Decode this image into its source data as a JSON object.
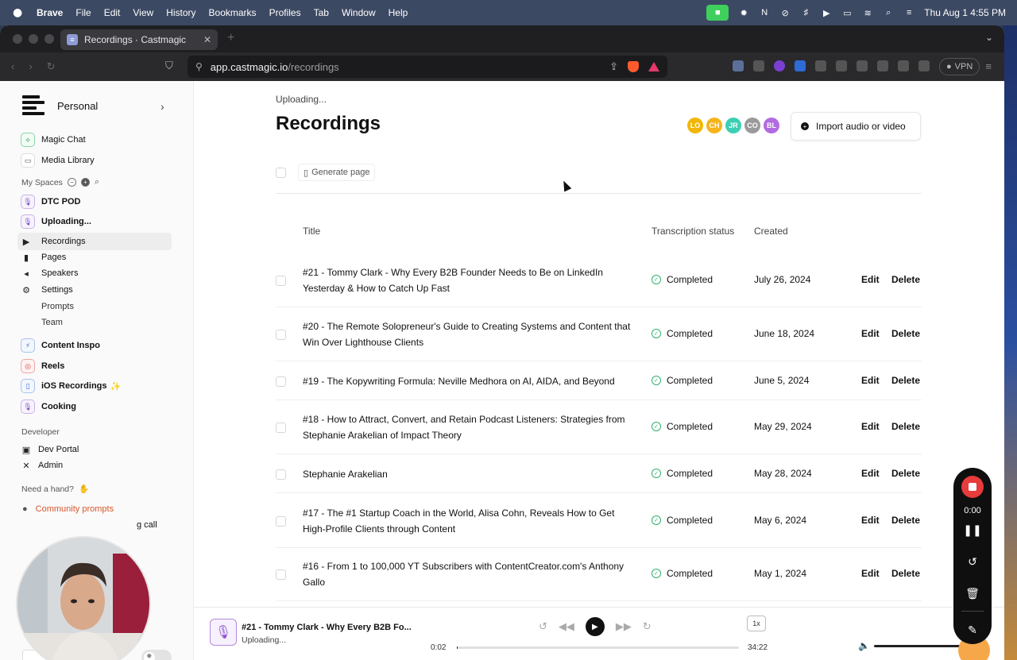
{
  "menubar": {
    "app": "Brave",
    "items": [
      "File",
      "Edit",
      "View",
      "History",
      "Bookmarks",
      "Profiles",
      "Tab",
      "Window",
      "Help"
    ],
    "clock": "Thu Aug 1  4:55 PM"
  },
  "browser": {
    "tab_title": "Recordings · Castmagic",
    "url_host": "app.castmagic.io",
    "url_path": "/recordings",
    "vpn_label": "VPN"
  },
  "sidebar": {
    "workspace": "Personal",
    "top_items": [
      {
        "label": "Magic Chat",
        "icon": "magic-chat-icon"
      },
      {
        "label": "Media Library",
        "icon": "folder-icon"
      }
    ],
    "my_spaces_label": "My Spaces",
    "spaces": [
      {
        "label": "DTC POD",
        "icon": "mic-icon"
      },
      {
        "label": "Uploading...",
        "icon": "mic-icon"
      }
    ],
    "space_nav": [
      {
        "label": "Recordings",
        "icon": "play-circle-icon"
      },
      {
        "label": "Pages",
        "icon": "page-icon"
      },
      {
        "label": "Speakers",
        "icon": "megaphone-icon"
      },
      {
        "label": "Settings",
        "icon": "gear-icon"
      }
    ],
    "settings_sub": [
      "Prompts",
      "Team"
    ],
    "more_spaces": [
      {
        "label": "Content Inspo",
        "icon": "bolt-icon"
      },
      {
        "label": "Reels",
        "icon": "target-icon"
      },
      {
        "label": "iOS Recordings",
        "icon": "phone-icon",
        "suffix": "✨"
      },
      {
        "label": "Cooking",
        "icon": "mic-icon"
      }
    ],
    "developer_label": "Developer",
    "developer_items": [
      {
        "label": "Dev Portal",
        "icon": "terminal-icon"
      },
      {
        "label": "Admin",
        "icon": "tools-icon"
      }
    ],
    "help_label": "Need a hand?",
    "community": "Community prompts",
    "book_call": "g call"
  },
  "main": {
    "uploading": "Uploading...",
    "title": "Recordings",
    "avatars": [
      {
        "initials": "LO",
        "color": "#f2b705"
      },
      {
        "initials": "CH",
        "color": "#f5b41c"
      },
      {
        "initials": "JR",
        "color": "#3ccfb4"
      },
      {
        "initials": "CO",
        "color": "#9a9a9a"
      },
      {
        "initials": "BL",
        "color": "#b26be0"
      }
    ],
    "import_label": "Import audio or video",
    "generate_label": "Generate page",
    "columns": {
      "title": "Title",
      "status": "Transcription status",
      "created": "Created"
    },
    "edit_label": "Edit",
    "delete_label": "Delete",
    "rows": [
      {
        "title": "#21 - Tommy Clark - Why Every B2B Founder Needs to Be on LinkedIn Yesterday & How to Catch Up Fast",
        "status": "Completed",
        "created": "July 26, 2024"
      },
      {
        "title": "#20 - The Remote Solopreneur's Guide to Creating Systems and Content that Win Over Lighthouse Clients",
        "status": "Completed",
        "created": "June 18, 2024"
      },
      {
        "title": "#19 - The Kopywriting Formula: Neville Medhora on AI, AIDA, and Beyond",
        "status": "Completed",
        "created": "June 5, 2024"
      },
      {
        "title": "#18 - How to Attract, Convert, and Retain Podcast Listeners: Strategies from Stephanie Arakelian of Impact Theory",
        "status": "Completed",
        "created": "May 29, 2024"
      },
      {
        "title": "Stephanie Arakelian",
        "status": "Completed",
        "created": "May 28, 2024"
      },
      {
        "title": "#17 - The #1 Startup Coach in the World, Alisa Cohn, Reveals How to Get High-Profile Clients through Content",
        "status": "Completed",
        "created": "May 6, 2024"
      },
      {
        "title": "#16 - From 1 to 100,000 YT Subscribers with ContentCreator.com's Anthony Gallo",
        "status": "Completed",
        "created": "May 1, 2024"
      }
    ]
  },
  "recorder": {
    "time": "0:00"
  },
  "player": {
    "title": "#21 - Tommy Clark - Why Every B2B Fo...",
    "subtitle": "Uploading...",
    "speed": "1x",
    "elapsed": "0:02",
    "duration": "34:22",
    "progress": 0.001,
    "volume": 1.0
  }
}
